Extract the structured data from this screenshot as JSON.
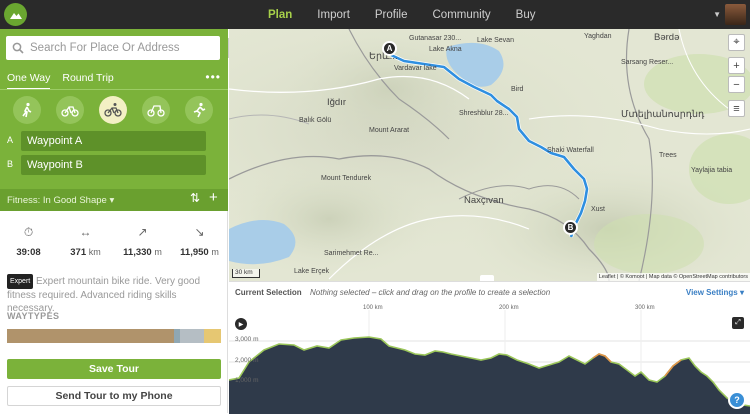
{
  "nav": {
    "items": [
      "Plan",
      "Import",
      "Profile",
      "Community",
      "Buy"
    ],
    "active": "Plan"
  },
  "sidebar": {
    "search_placeholder": "Search For Place Or Address",
    "tabs": [
      "One Way",
      "Round Trip"
    ],
    "more": "•••",
    "sports": [
      "hiking",
      "bike-touring",
      "mountain-bike",
      "road-cycling",
      "running"
    ],
    "selected_sport": "mountain-bike",
    "waypoints": [
      {
        "letter": "A",
        "name": "Waypoint A"
      },
      {
        "letter": "B",
        "name": "Waypoint B"
      }
    ],
    "fitness": "Fitness: In Good Shape",
    "stats": {
      "duration": "39:08",
      "distance_value": "371",
      "distance_unit": "km",
      "uphill_value": "11,330",
      "uphill_unit": "m",
      "downhill_value": "11,950",
      "downhill_unit": "m"
    },
    "difficulty_badge": "Expert",
    "description": "Expert mountain bike ride. Very good fitness required. Advanced riding skills necessary.",
    "waytypes_title": "WAYTYPES",
    "waytypes": [
      {
        "color": "#b0936b",
        "fraction": 0.78
      },
      {
        "color": "#8fa7b3",
        "fraction": 0.03
      },
      {
        "color": "#b5bec4",
        "fraction": 0.11
      },
      {
        "color": "#e6c772",
        "fraction": 0.08
      }
    ],
    "save_label": "Save Tour",
    "phone_label": "Send Tour to my Phone"
  },
  "map": {
    "labels": [
      "Gutanasar 230...",
      "Lake Sevan",
      "Lake Akna",
      "Yaghdan",
      "Vardavar lake",
      "Sarsang Reser...",
      "Bird",
      "Iğdır",
      "Balık Gölü",
      "Mount Ararat",
      "Shreshblur 28...",
      "Shaki Waterfall",
      "Trees",
      "Yaylajia tabia",
      "Mount Tendurek",
      "Naxçıvan",
      "Xust",
      "Sarimehmet Re...",
      "Lake Erçek",
      "Bərdə",
      "Մտելիանոսրդնդ"
    ],
    "city_label": "Երև...",
    "scale": "30 km",
    "attribution": "Leaflet | © Komoot | Map data © OpenStreetMap contributors",
    "markers": [
      "A",
      "B"
    ],
    "route_color": "#2f8fe0"
  },
  "profile": {
    "title": "Current Selection",
    "hint": "Nothing selected – click and drag on the profile to create a selection",
    "view_settings": "View Settings",
    "x_ticks": [
      "100 km",
      "200 km",
      "300 km"
    ],
    "y_ticks": [
      "3,000 m",
      "2,000 m",
      "1,000 m"
    ]
  }
}
